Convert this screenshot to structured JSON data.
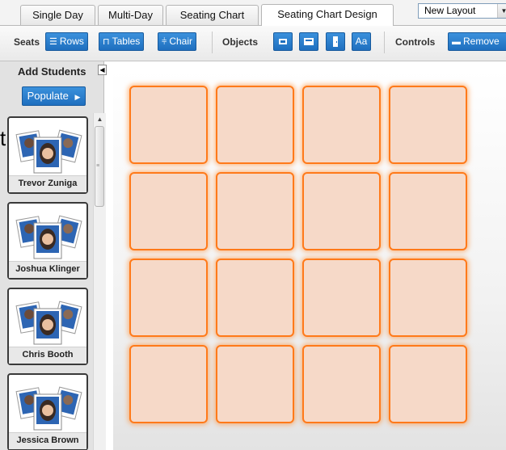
{
  "tabs": [
    {
      "label": "Single Day"
    },
    {
      "label": "Multi-Day"
    },
    {
      "label": "Seating Chart"
    },
    {
      "label": "Seating Chart Design",
      "active": true
    }
  ],
  "layout_select": {
    "value": "New Layout"
  },
  "toolbar": {
    "seats_label": "Seats",
    "rows_label": "Rows",
    "tables_label": "Tables",
    "chair_label": "Chair",
    "objects_label": "Objects",
    "object_text_label": "Aa",
    "controls_label": "Controls",
    "remove_label": "Remove"
  },
  "left_panel": {
    "title": "Add Students",
    "populate_label": "Populate",
    "students": [
      {
        "name": "Trevor Zuniga"
      },
      {
        "name": "Joshua Klinger"
      },
      {
        "name": "Chris Booth"
      },
      {
        "name": "Jessica Brown"
      }
    ]
  },
  "canvas": {
    "rows": 4,
    "cols": 4,
    "seat_color": "#f6d9c8",
    "seat_border_color": "#ff7a1a"
  },
  "stray": {
    "glyph": "t"
  },
  "colors": {
    "accent": "#1f6fbf",
    "seat_glow": "#ff7a1a"
  }
}
